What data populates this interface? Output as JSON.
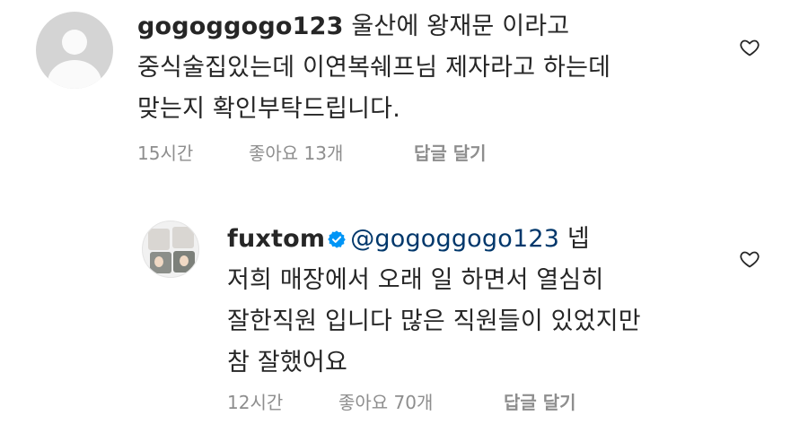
{
  "comments": [
    {
      "username": "gogoggogo123",
      "lines": [
        "울산에 왕재문 이라고",
        "중식술집있는데 이연복쉐프님 제자라고 하는데",
        "맞는지 확인부탁드립니다."
      ],
      "time": "15시간",
      "likes": "좋아요 13개",
      "reply": "답글 달기"
    },
    {
      "username": "fuxtom",
      "verified": true,
      "mention": "@gogoggogo123",
      "lines": [
        "넵",
        "저희 매장에서 오래 일 하면서  열심히",
        "잘한직원 입니다  많은 직원들이  있었지만",
        "참 잘했어요"
      ],
      "time": "12시간",
      "likes": "좋아요 70개",
      "reply": "답글 달기"
    }
  ],
  "icons": {
    "default_avatar": "default-avatar-icon",
    "verified": "verified-badge-icon",
    "like": "heart-outline-icon"
  },
  "colors": {
    "text": "#262626",
    "secondary": "#8e8e8e",
    "mention": "#00376b",
    "verified": "#0095f6"
  }
}
